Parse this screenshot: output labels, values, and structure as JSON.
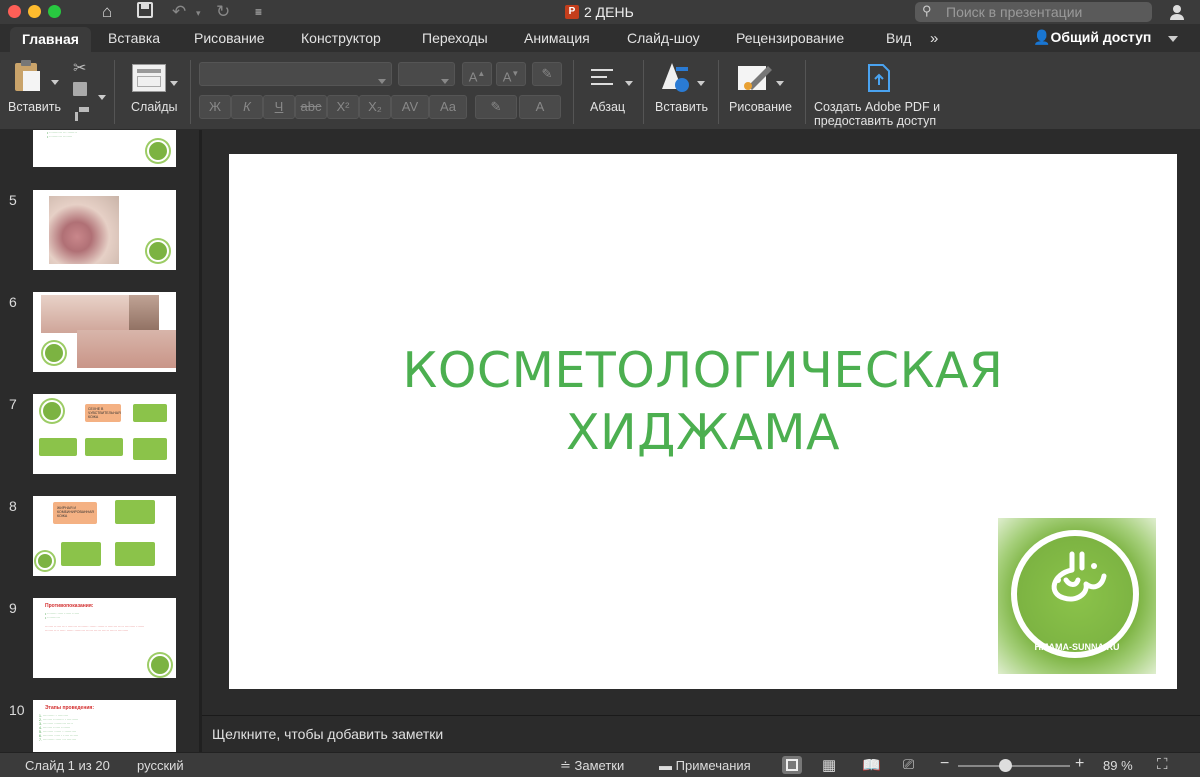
{
  "window": {
    "title": "2 ДЕНЬ",
    "search_placeholder": "Поиск в презентации"
  },
  "tabs": [
    "Главная",
    "Вставка",
    "Рисование",
    "Конструктор",
    "Переходы",
    "Анимация",
    "Слайд-шоу",
    "Рецензирование",
    "Вид"
  ],
  "tabs_more": "»",
  "share_label": "Общий доступ",
  "ribbon": {
    "paste_label": "Вставить",
    "slides_label": "Слайды",
    "paragraph_label": "Абзац",
    "insert_label": "Вставить",
    "draw_label": "Рисование",
    "adobe_label_1": "Создать Adobe PDF и",
    "adobe_label_2": "предоставить доступ",
    "bold": "Ж",
    "italic": "К",
    "underline": "Ч",
    "strike": "abc",
    "superscript": "X²",
    "subscript": "X₂",
    "spacing": "AV",
    "case": "Aa",
    "grow": "A",
    "shrink": "A"
  },
  "thumbnails": [
    {
      "num": "5"
    },
    {
      "num": "6"
    },
    {
      "num": "7"
    },
    {
      "num": "8"
    },
    {
      "num": "9"
    },
    {
      "num": "10"
    }
  ],
  "thumb_texts": {
    "s7_center": "СЕХНЕ В ЧУВСТВИТЕЛЬНАЯ КОЖА",
    "s8_top": "ЖИРНАЯ И КОМБИНИРОВАННАЯ КОЖА",
    "s9_title": "Противопоказания:",
    "s10_title": "Этапы проведения:"
  },
  "slide": {
    "title_line1": "КОСМЕТОЛОГИЧЕСКАЯ",
    "title_line2": "ХИДЖАМА",
    "logo_text": "HIJAMA-SUNNA.RU"
  },
  "notes_placeholder": "Щелкните, чтобы добавить заметки",
  "status": {
    "slide_counter": "Слайд 1 из 20",
    "language": "русский",
    "notes_btn": "Заметки",
    "comments_btn": "Примечания",
    "zoom": "89 %"
  },
  "colors": {
    "accent_green": "#4caf50",
    "chrome": "#3b3b3b"
  }
}
